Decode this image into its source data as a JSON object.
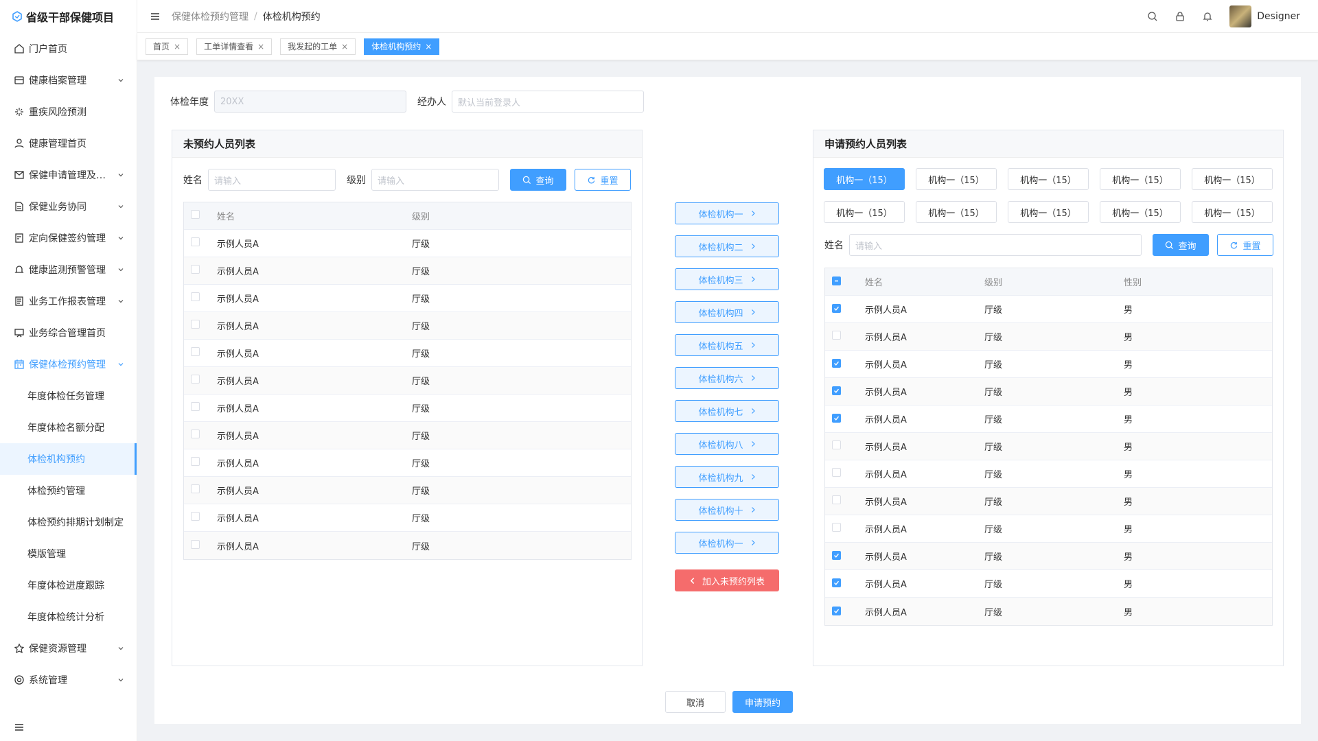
{
  "app": {
    "title": "省级干部保健项目"
  },
  "sidebar": {
    "items": [
      {
        "label": "门户首页",
        "icon": "home-icon",
        "arrow": false
      },
      {
        "label": "健康档案管理",
        "icon": "archive-icon",
        "arrow": true
      },
      {
        "label": "重疾风险预测",
        "icon": "sparkle-icon",
        "arrow": false
      },
      {
        "label": "健康管理首页",
        "icon": "user-icon",
        "arrow": false
      },
      {
        "label": "保健申请管理及…",
        "icon": "mail-icon",
        "arrow": true
      },
      {
        "label": "保健业务协同",
        "icon": "document-icon",
        "arrow": true
      },
      {
        "label": "定向保健签约管理",
        "icon": "contract-icon",
        "arrow": true
      },
      {
        "label": "健康监测预警管理",
        "icon": "bell-icon",
        "arrow": true
      },
      {
        "label": "业务工作报表管理",
        "icon": "report-icon",
        "arrow": true
      },
      {
        "label": "业务综合管理首页",
        "icon": "board-icon",
        "arrow": false
      },
      {
        "label": "保健体检预约管理",
        "icon": "calendar-icon",
        "arrow": true
      }
    ],
    "subitems": [
      {
        "label": "年度体检任务管理"
      },
      {
        "label": "年度体检名额分配"
      },
      {
        "label": "体检机构预约"
      },
      {
        "label": "体检预约管理"
      },
      {
        "label": "体检预约排期计划制定"
      },
      {
        "label": "模版管理"
      },
      {
        "label": "年度体检进度跟踪"
      },
      {
        "label": "年度体检统计分析"
      }
    ],
    "bottom_items": [
      {
        "label": "保健资源管理",
        "icon": "star-icon"
      },
      {
        "label": "系统管理",
        "icon": "settings-icon"
      }
    ]
  },
  "header": {
    "breadcrumb_parent": "保健体检预约管理",
    "breadcrumb_sep": "/",
    "breadcrumb_current": "体检机构预约",
    "username": "Designer"
  },
  "tabs": [
    {
      "label": "首页",
      "active": false
    },
    {
      "label": "工单详情查看",
      "active": false
    },
    {
      "label": "我发起的工单",
      "active": false
    },
    {
      "label": "体检机构预约",
      "active": true
    }
  ],
  "form": {
    "year_label": "体检年度",
    "year_placeholder": "20XX",
    "handler_label": "经办人",
    "handler_placeholder": "默认当前登录人"
  },
  "left_panel": {
    "title": "未预约人员列表",
    "name_label": "姓名",
    "name_placeholder": "请输入",
    "level_label": "级别",
    "level_placeholder": "请输入",
    "search_label": "查询",
    "reset_label": "重置",
    "columns": [
      "姓名",
      "级别"
    ],
    "rows": [
      [
        "示例人员A",
        "厅级"
      ],
      [
        "示例人员A",
        "厅级"
      ],
      [
        "示例人员A",
        "厅级"
      ],
      [
        "示例人员A",
        "厅级"
      ],
      [
        "示例人员A",
        "厅级"
      ],
      [
        "示例人员A",
        "厅级"
      ],
      [
        "示例人员A",
        "厅级"
      ],
      [
        "示例人员A",
        "厅级"
      ],
      [
        "示例人员A",
        "厅级"
      ],
      [
        "示例人员A",
        "厅级"
      ],
      [
        "示例人员A",
        "厅级"
      ],
      [
        "示例人员A",
        "厅级"
      ]
    ]
  },
  "middle": {
    "org_buttons": [
      "体检机构一",
      "体检机构二",
      "体检机构三",
      "体检机构四",
      "体检机构五",
      "体检机构六",
      "体检机构七",
      "体检机构八",
      "体检机构九",
      "体检机构十",
      "体检机构一"
    ],
    "add_back_label": "加入未预约列表"
  },
  "right_panel": {
    "title": "申请预约人员列表",
    "institutions": [
      {
        "label": "机构一（15）",
        "active": true
      },
      {
        "label": "机构一（15）",
        "active": false
      },
      {
        "label": "机构一（15）",
        "active": false
      },
      {
        "label": "机构一（15）",
        "active": false
      },
      {
        "label": "机构一（15）",
        "active": false
      },
      {
        "label": "机构一（15）",
        "active": false
      },
      {
        "label": "机构一（15）",
        "active": false
      },
      {
        "label": "机构一（15）",
        "active": false
      },
      {
        "label": "机构一（15）",
        "active": false
      },
      {
        "label": "机构一（15）",
        "active": false
      }
    ],
    "name_label": "姓名",
    "name_placeholder": "请输入",
    "search_label": "查询",
    "reset_label": "重置",
    "columns": [
      "姓名",
      "级别",
      "性别"
    ],
    "rows": [
      {
        "cells": [
          "示例人员A",
          "厅级",
          "男"
        ],
        "checked": true
      },
      {
        "cells": [
          "示例人员A",
          "厅级",
          "男"
        ],
        "checked": false
      },
      {
        "cells": [
          "示例人员A",
          "厅级",
          "男"
        ],
        "checked": true
      },
      {
        "cells": [
          "示例人员A",
          "厅级",
          "男"
        ],
        "checked": true
      },
      {
        "cells": [
          "示例人员A",
          "厅级",
          "男"
        ],
        "checked": true
      },
      {
        "cells": [
          "示例人员A",
          "厅级",
          "男"
        ],
        "checked": false
      },
      {
        "cells": [
          "示例人员A",
          "厅级",
          "男"
        ],
        "checked": false
      },
      {
        "cells": [
          "示例人员A",
          "厅级",
          "男"
        ],
        "checked": false
      },
      {
        "cells": [
          "示例人员A",
          "厅级",
          "男"
        ],
        "checked": false
      },
      {
        "cells": [
          "示例人员A",
          "厅级",
          "男"
        ],
        "checked": true
      },
      {
        "cells": [
          "示例人员A",
          "厅级",
          "男"
        ],
        "checked": true
      },
      {
        "cells": [
          "示例人员A",
          "厅级",
          "男"
        ],
        "checked": true
      }
    ]
  },
  "footer": {
    "cancel_label": "取消",
    "submit_label": "申请预约"
  },
  "colors": {
    "primary": "#409eff",
    "danger": "#f56c6c"
  }
}
